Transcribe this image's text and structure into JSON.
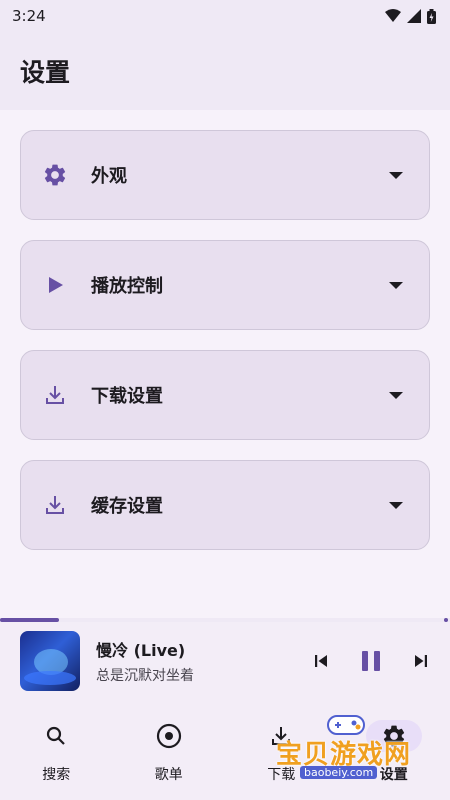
{
  "status_bar": {
    "time": "3:24",
    "icons": [
      "wifi-icon",
      "signal-icon",
      "battery-icon"
    ]
  },
  "app_bar": {
    "title": "设置"
  },
  "settings": [
    {
      "label": "外观",
      "icon": "gear-icon"
    },
    {
      "label": "播放控制",
      "icon": "play-icon"
    },
    {
      "label": "下载设置",
      "icon": "download-icon"
    },
    {
      "label": "缓存设置",
      "icon": "download-icon"
    }
  ],
  "player": {
    "title": "慢冷 (Live)",
    "artist": "总是沉默对坐着",
    "progress": 0.13,
    "state": "playing"
  },
  "bottom_nav": [
    {
      "label": "搜索",
      "icon": "search-icon",
      "active": false
    },
    {
      "label": "歌单",
      "icon": "disc-icon",
      "active": false
    },
    {
      "label": "下载",
      "icon": "download-icon",
      "active": false
    },
    {
      "label": "设置",
      "icon": "gear-icon",
      "active": true
    }
  ],
  "watermark": {
    "text": "宝贝游戏网",
    "url": "baobeiy.com"
  },
  "colors": {
    "accent": "#6750a4",
    "card": "#e8dfef",
    "background": "#f7f2fa"
  }
}
